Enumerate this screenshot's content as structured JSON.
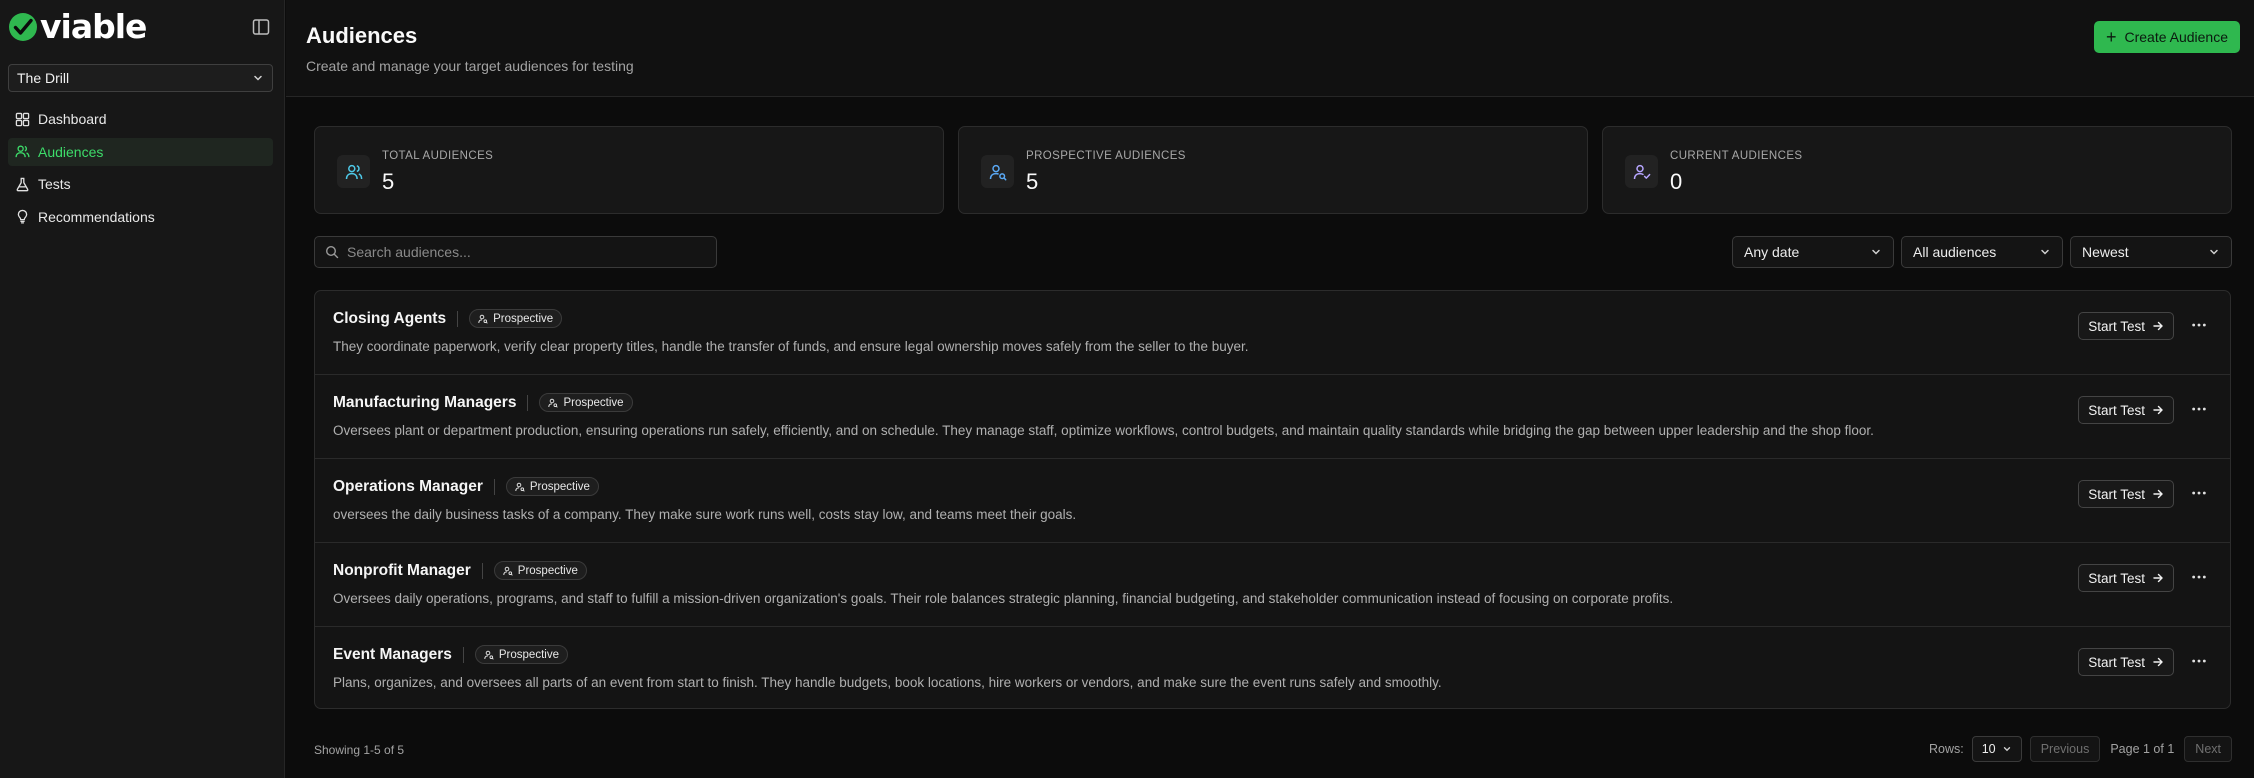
{
  "app": {
    "logo_text": "viable",
    "brand_color": "#2fb84f"
  },
  "sidebar": {
    "workspace": "The Drill",
    "items": [
      {
        "label": "Dashboard",
        "icon": "dashboard-icon",
        "active": false
      },
      {
        "label": "Audiences",
        "icon": "users-icon",
        "active": true
      },
      {
        "label": "Tests",
        "icon": "flask-icon",
        "active": false
      },
      {
        "label": "Recommendations",
        "icon": "lightbulb-icon",
        "active": false
      }
    ]
  },
  "header": {
    "title": "Audiences",
    "subtitle": "Create and manage your target audiences for testing",
    "create_label": "Create Audience"
  },
  "stats": [
    {
      "label": "TOTAL AUDIENCES",
      "value": "5",
      "icon": "users-icon"
    },
    {
      "label": "PROSPECTIVE AUDIENCES",
      "value": "5",
      "icon": "user-search-icon"
    },
    {
      "label": "CURRENT AUDIENCES",
      "value": "0",
      "icon": "user-check-icon"
    }
  ],
  "filters": {
    "search_placeholder": "Search audiences...",
    "date": "Any date",
    "audience": "All audiences",
    "sort": "Newest"
  },
  "audiences": [
    {
      "title": "Closing Agents",
      "badge": "Prospective",
      "description": "They coordinate paperwork, verify clear property titles, handle the transfer of funds, and ensure legal ownership moves safely from the seller to the buyer."
    },
    {
      "title": "Manufacturing Managers",
      "badge": "Prospective",
      "description": "Oversees plant or department production, ensuring operations run safely, efficiently, and on schedule. They manage staff, optimize workflows, control budgets, and maintain quality standards while bridging the gap between upper leadership and the shop floor."
    },
    {
      "title": "Operations Manager",
      "badge": "Prospective",
      "description": "oversees the daily business tasks of a company. They make sure work runs well, costs stay low, and teams meet their goals."
    },
    {
      "title": "Nonprofit Manager",
      "badge": "Prospective",
      "description": "Oversees daily operations, programs, and staff to fulfill a mission-driven organization's goals. Their role balances strategic planning, financial budgeting, and stakeholder communication instead of focusing on corporate profits."
    },
    {
      "title": "Event Managers",
      "badge": "Prospective",
      "description": "Plans, organizes, and oversees all parts of an event from start to finish. They handle budgets, book locations, hire workers or vendors, and make sure the event runs safely and smoothly."
    }
  ],
  "row_actions": {
    "start_label": "Start Test"
  },
  "footer": {
    "showing": "Showing 1-5 of 5",
    "rows_label": "Rows:",
    "rows_value": "10",
    "previous": "Previous",
    "page_info": "Page 1 of 1",
    "next": "Next"
  }
}
